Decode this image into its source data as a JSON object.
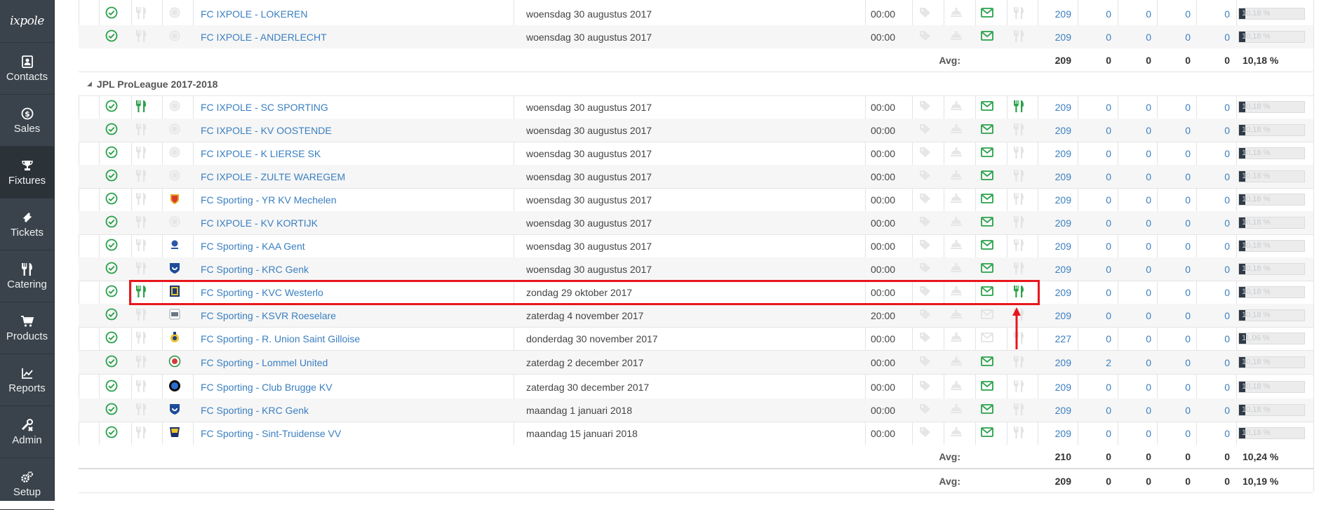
{
  "sidebar": {
    "logo": "ixpole",
    "items": [
      {
        "label": "Contacts",
        "icon": "contacts-icon",
        "active": false
      },
      {
        "label": "Sales",
        "icon": "dollar-icon",
        "active": false
      },
      {
        "label": "Fixtures",
        "icon": "trophy-icon",
        "active": true
      },
      {
        "label": "Tickets",
        "icon": "ticket-icon",
        "active": false
      },
      {
        "label": "Catering",
        "icon": "cutlery-icon",
        "active": false
      },
      {
        "label": "Products",
        "icon": "cart-icon",
        "active": false
      },
      {
        "label": "Reports",
        "icon": "chart-icon",
        "active": false
      },
      {
        "label": "Admin",
        "icon": "tools-icon",
        "active": false
      },
      {
        "label": "Setup",
        "icon": "gears-icon",
        "active": false
      }
    ]
  },
  "colors": {
    "accent_link": "#3a7fc1",
    "success_green": "#2aa14b",
    "highlight_red": "#e8161c",
    "sidebar_bg": "#3a434b"
  },
  "group_previous": {
    "rows": [
      {
        "catering": false,
        "logo": "placeholder-logo",
        "fixture": "FC IXPOLE - LOKEREN",
        "date": "woensdag 30 augustus 2017",
        "time": "00:00",
        "mail": true,
        "catering2": false,
        "v1": "209",
        "v2": "0",
        "v3": "0",
        "v4": "0",
        "v5": "0",
        "pct": "10,18 %",
        "fill": 0.1018
      },
      {
        "catering": false,
        "logo": "placeholder-logo",
        "fixture": "FC IXPOLE - ANDERLECHT",
        "date": "woensdag 30 augustus 2017",
        "time": "00:00",
        "mail": true,
        "catering2": false,
        "v1": "209",
        "v2": "0",
        "v3": "0",
        "v4": "0",
        "v5": "0",
        "pct": "10,18 %",
        "fill": 0.1018
      }
    ],
    "avg": {
      "label": "Avg:",
      "v1": "209",
      "v2": "0",
      "v3": "0",
      "v4": "0",
      "v5": "0",
      "pct": "10,18 %"
    }
  },
  "group_jpl": {
    "title": "JPL ProLeague 2017-2018",
    "rows": [
      {
        "catering": true,
        "logo": "placeholder-logo",
        "fixture": "FC IXPOLE - SC SPORTING",
        "date": "woensdag 30 augustus 2017",
        "time": "00:00",
        "mail": true,
        "catering2": true,
        "v1": "209",
        "v2": "0",
        "v3": "0",
        "v4": "0",
        "v5": "0",
        "pct": "10,18 %",
        "fill": 0.1018
      },
      {
        "catering": false,
        "logo": "placeholder-logo",
        "fixture": "FC IXPOLE - KV OOSTENDE",
        "date": "woensdag 30 augustus 2017",
        "time": "00:00",
        "mail": true,
        "catering2": false,
        "v1": "209",
        "v2": "0",
        "v3": "0",
        "v4": "0",
        "v5": "0",
        "pct": "10,18 %",
        "fill": 0.1018
      },
      {
        "catering": false,
        "logo": "placeholder-logo",
        "fixture": "FC IXPOLE - K LIERSE SK",
        "date": "woensdag 30 augustus 2017",
        "time": "00:00",
        "mail": true,
        "catering2": false,
        "v1": "209",
        "v2": "0",
        "v3": "0",
        "v4": "0",
        "v5": "0",
        "pct": "10,18 %",
        "fill": 0.1018
      },
      {
        "catering": false,
        "logo": "placeholder-logo",
        "fixture": "FC IXPOLE - ZULTE WAREGEM",
        "date": "woensdag 30 augustus 2017",
        "time": "00:00",
        "mail": true,
        "catering2": false,
        "v1": "209",
        "v2": "0",
        "v3": "0",
        "v4": "0",
        "v5": "0",
        "pct": "10,18 %",
        "fill": 0.1018
      },
      {
        "catering": false,
        "logo": "mechelen-logo",
        "fixture": "FC Sporting - YR KV Mechelen",
        "date": "woensdag 30 augustus 2017",
        "time": "00:00",
        "mail": true,
        "catering2": false,
        "v1": "209",
        "v2": "0",
        "v3": "0",
        "v4": "0",
        "v5": "0",
        "pct": "10,18 %",
        "fill": 0.1018
      },
      {
        "catering": false,
        "logo": "placeholder-logo",
        "fixture": "FC IXPOLE - KV KORTIJK",
        "date": "woensdag 30 augustus 2017",
        "time": "00:00",
        "mail": true,
        "catering2": false,
        "v1": "209",
        "v2": "0",
        "v3": "0",
        "v4": "0",
        "v5": "0",
        "pct": "10,18 %",
        "fill": 0.1018
      },
      {
        "catering": false,
        "logo": "gent-logo",
        "fixture": "FC Sporting - KAA Gent",
        "date": "woensdag 30 augustus 2017",
        "time": "00:00",
        "mail": true,
        "catering2": false,
        "v1": "209",
        "v2": "0",
        "v3": "0",
        "v4": "0",
        "v5": "0",
        "pct": "10,18 %",
        "fill": 0.1018
      },
      {
        "catering": false,
        "logo": "genk-logo",
        "fixture": "FC Sporting - KRC Genk",
        "date": "woensdag 30 augustus 2017",
        "time": "00:00",
        "mail": true,
        "catering2": false,
        "v1": "209",
        "v2": "0",
        "v3": "0",
        "v4": "0",
        "v5": "0",
        "pct": "10,18 %",
        "fill": 0.1018
      },
      {
        "catering": true,
        "logo": "westerlo-logo",
        "fixture": "FC Sporting - KVC Westerlo",
        "date": "zondag 29 oktober 2017",
        "time": "00:00",
        "mail": true,
        "catering2": true,
        "v1": "209",
        "v2": "0",
        "v3": "0",
        "v4": "0",
        "v5": "0",
        "pct": "10,18 %",
        "fill": 0.1018
      },
      {
        "catering": false,
        "logo": "roeselare-logo",
        "fixture": "FC Sporting - KSVR Roeselare",
        "date": "zaterdag 4 november 2017",
        "time": "20:00",
        "mail": false,
        "catering2": false,
        "v1": "209",
        "v2": "0",
        "v3": "0",
        "v4": "0",
        "v5": "0",
        "pct": "10,18 %",
        "fill": 0.1018
      },
      {
        "catering": false,
        "logo": "union-logo",
        "fixture": "FC Sporting - R. Union Saint Gilloise",
        "date": "donderdag 30 november 2017",
        "time": "00:00",
        "mail": false,
        "catering2": false,
        "v1": "227",
        "v2": "0",
        "v3": "0",
        "v4": "0",
        "v5": "0",
        "pct": "11,06 %",
        "fill": 0.1106
      },
      {
        "catering": false,
        "logo": "lommel-logo",
        "fixture": "FC Sporting - Lommel United",
        "date": "zaterdag 2 december 2017",
        "time": "00:00",
        "mail": true,
        "catering2": false,
        "v1": "209",
        "v2": "2",
        "v3": "0",
        "v4": "0",
        "v5": "0",
        "pct": "10,18 %",
        "fill": 0.1018
      },
      {
        "catering": false,
        "logo": "brugge-logo",
        "fixture": "FC Sporting - Club Brugge KV",
        "date": "zaterdag 30 december 2017",
        "time": "00:00",
        "mail": true,
        "catering2": false,
        "v1": "209",
        "v2": "0",
        "v3": "0",
        "v4": "0",
        "v5": "0",
        "pct": "10,18 %",
        "fill": 0.1018
      },
      {
        "catering": false,
        "logo": "genk-logo",
        "fixture": "FC Sporting - KRC Genk",
        "date": "maandag 1 januari 2018",
        "time": "00:00",
        "mail": true,
        "catering2": false,
        "v1": "209",
        "v2": "0",
        "v3": "0",
        "v4": "0",
        "v5": "0",
        "pct": "10,18 %",
        "fill": 0.1018
      },
      {
        "catering": false,
        "logo": "stvv-logo",
        "fixture": "FC Sporting - Sint-Truidense VV",
        "date": "maandag 15 januari 2018",
        "time": "00:00",
        "mail": true,
        "catering2": false,
        "v1": "209",
        "v2": "0",
        "v3": "0",
        "v4": "0",
        "v5": "0",
        "pct": "10,18 %",
        "fill": 0.1018
      }
    ],
    "avg": {
      "label": "Avg:",
      "v1": "210",
      "v2": "0",
      "v3": "0",
      "v4": "0",
      "v5": "0",
      "pct": "10,24 %"
    }
  },
  "total_avg": {
    "label": "Avg:",
    "v1": "209",
    "v2": "0",
    "v3": "0",
    "v4": "0",
    "v5": "0",
    "pct": "10,19 %"
  }
}
